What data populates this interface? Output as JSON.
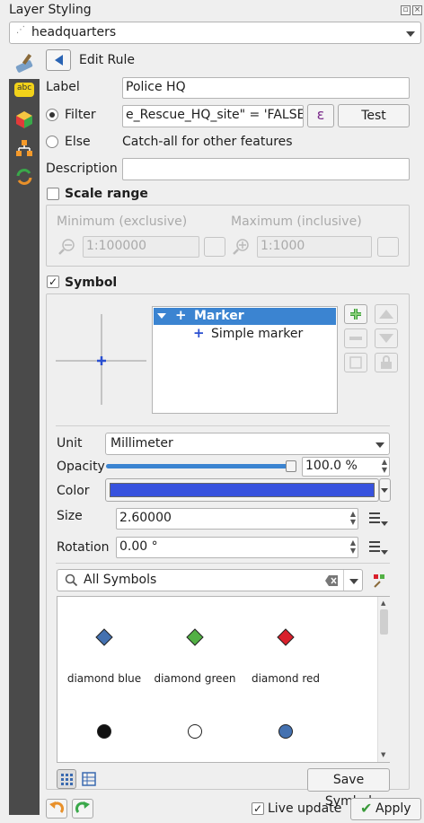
{
  "window": {
    "title": "Layer Styling"
  },
  "layer_selector": {
    "value": "headquarters"
  },
  "panel": {
    "title": "Edit Rule"
  },
  "rule": {
    "label_caption": "Label",
    "label_value": "Police HQ",
    "filter_caption": "Filter",
    "filter_value": "e_Rescue_HQ_site\" = 'FALSE'",
    "filter_expr_icon": "ε",
    "test_label": "Test",
    "else_caption": "Else",
    "else_text": "Catch-all for other features",
    "description_caption": "Description",
    "description_value": ""
  },
  "scale_range": {
    "title": "Scale range",
    "enabled": false,
    "min_caption": "Minimum (exclusive)",
    "max_caption": "Maximum (inclusive)",
    "min_value": "1:100000",
    "max_value": "1:1000"
  },
  "symbol": {
    "title": "Symbol",
    "enabled": true,
    "tree": {
      "root": "Marker",
      "child": "Simple marker"
    },
    "unit_caption": "Unit",
    "unit_value": "Millimeter",
    "opacity_caption": "Opacity",
    "opacity_value": "100.0 %",
    "opacity_fraction": 1.0,
    "color_caption": "Color",
    "color_value": "#3752de",
    "size_caption": "Size",
    "size_value": "2.60000",
    "rotation_caption": "Rotation",
    "rotation_value": "0.00 °"
  },
  "library": {
    "search_value": "All Symbols",
    "symbols": [
      {
        "name": "diamond blue",
        "shape": "diamond",
        "color": "#4471b0"
      },
      {
        "name": "diamond green",
        "shape": "diamond",
        "color": "#52b044"
      },
      {
        "name": "diamond red",
        "shape": "diamond",
        "color": "#d9202c"
      },
      {
        "name": "",
        "shape": "circle",
        "color": "#111111"
      },
      {
        "name": "",
        "shape": "circle",
        "color": "#ffffff"
      },
      {
        "name": "",
        "shape": "circle",
        "color": "#4471b0"
      }
    ],
    "save_label": "Save Symbol"
  },
  "footer": {
    "live_update_label": "Live update",
    "live_update_enabled": true,
    "apply_label": "Apply"
  },
  "colors": {
    "accent": "#3b84d1",
    "marker_cross": "#2a4fd0",
    "sidebar": "#4a4a4a"
  }
}
